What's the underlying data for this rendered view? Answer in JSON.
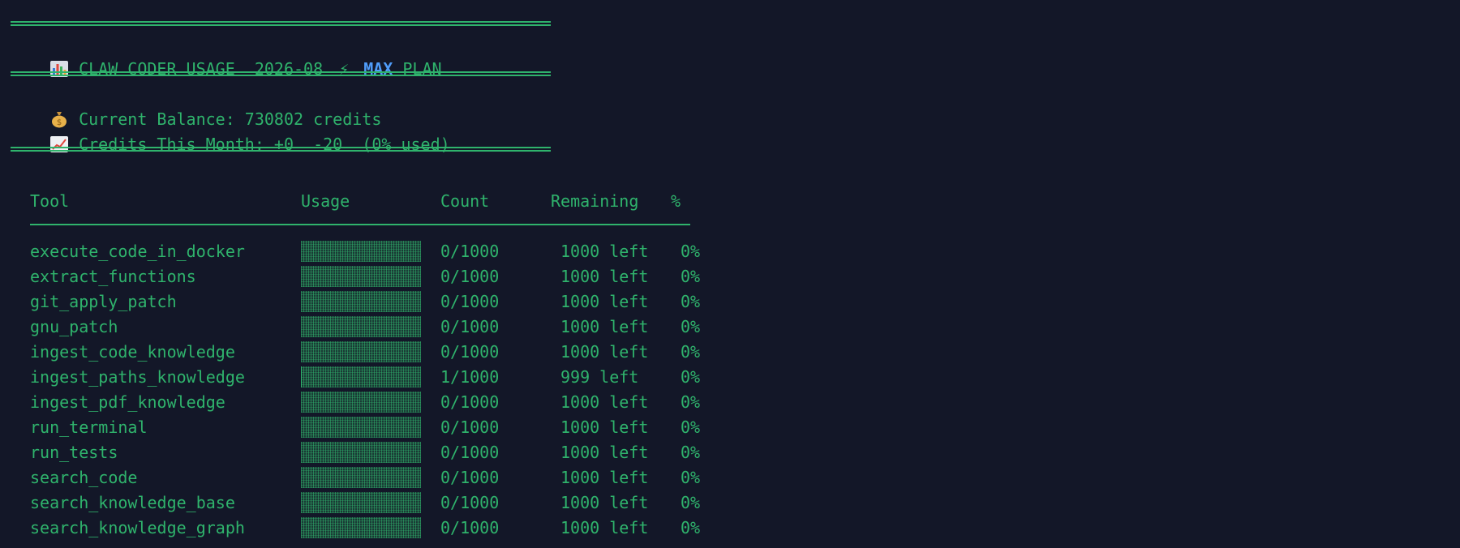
{
  "header": {
    "title": "CLAW CODER USAGE",
    "period": "2026-08",
    "bolt": "⚡",
    "plan_accent": "MAX",
    "plan_suffix": "PLAN"
  },
  "summary": {
    "balance": "Current Balance: 730802 credits",
    "credits_month": "Credits This Month: +0  -20  (0% used)"
  },
  "table": {
    "columns": [
      "Tool",
      "Usage",
      "Count",
      "Remaining",
      "%"
    ],
    "rows": [
      {
        "tool": "execute_code_in_docker",
        "usage_fraction": 0.0,
        "count": "0/1000",
        "remaining": "1000 left",
        "percent": "0%"
      },
      {
        "tool": "extract_functions",
        "usage_fraction": 0.0,
        "count": "0/1000",
        "remaining": "1000 left",
        "percent": "0%"
      },
      {
        "tool": "git_apply_patch",
        "usage_fraction": 0.0,
        "count": "0/1000",
        "remaining": "1000 left",
        "percent": "0%"
      },
      {
        "tool": "gnu_patch",
        "usage_fraction": 0.0,
        "count": "0/1000",
        "remaining": "1000 left",
        "percent": "0%"
      },
      {
        "tool": "ingest_code_knowledge",
        "usage_fraction": 0.0,
        "count": "0/1000",
        "remaining": "1000 left",
        "percent": "0%"
      },
      {
        "tool": "ingest_paths_knowledge",
        "usage_fraction": 0.001,
        "count": "1/1000",
        "remaining": "999 left",
        "percent": "0%"
      },
      {
        "tool": "ingest_pdf_knowledge",
        "usage_fraction": 0.0,
        "count": "0/1000",
        "remaining": "1000 left",
        "percent": "0%"
      },
      {
        "tool": "run_terminal",
        "usage_fraction": 0.0,
        "count": "0/1000",
        "remaining": "1000 left",
        "percent": "0%"
      },
      {
        "tool": "run_tests",
        "usage_fraction": 0.0,
        "count": "0/1000",
        "remaining": "1000 left",
        "percent": "0%"
      },
      {
        "tool": "search_code",
        "usage_fraction": 0.0,
        "count": "0/1000",
        "remaining": "1000 left",
        "percent": "0%"
      },
      {
        "tool": "search_knowledge_base",
        "usage_fraction": 0.0,
        "count": "0/1000",
        "remaining": "1000 left",
        "percent": "0%"
      },
      {
        "tool": "search_knowledge_graph",
        "usage_fraction": 0.0,
        "count": "0/1000",
        "remaining": "1000 left",
        "percent": "0%"
      }
    ]
  },
  "icons": {
    "header": "bar-chart-icon",
    "balance": "money-bag-icon",
    "credits": "trend-up-icon"
  },
  "colors": {
    "background": "#131728",
    "text": "#2fb36c",
    "accent": "#4f9cf9"
  }
}
